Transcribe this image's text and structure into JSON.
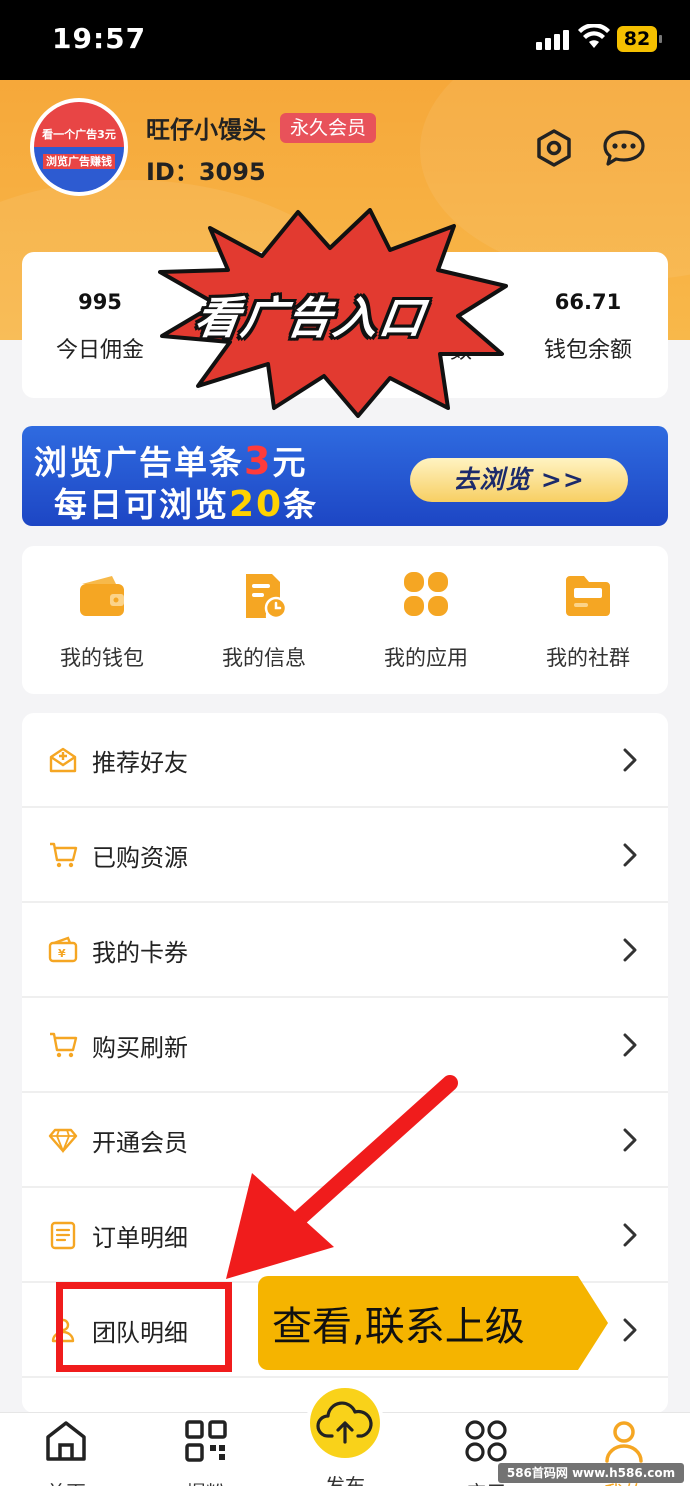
{
  "status_bar": {
    "time": "19:57",
    "battery": "82"
  },
  "profile": {
    "avatar_top": "看一个广告3元",
    "avatar_bottom": "浏览广告赚钱",
    "username": "旺仔小馒头",
    "member_badge": "永久会员",
    "id_text": "ID：3095"
  },
  "stats": [
    {
      "value": "995",
      "label": "今日佣金"
    },
    {
      "value": "66.71",
      "label": "钱包余额"
    }
  ],
  "stats_partial_label": "数",
  "overlay_burst": "看广告入口",
  "banner": {
    "line1_a": "浏览广告单条",
    "line1_num": "3",
    "line1_b": "元",
    "line2_a": "每日可浏览",
    "line2_num": "20",
    "line2_b": "条",
    "button": "去浏览 >>"
  },
  "quick_grid": [
    {
      "label": "我的钱包",
      "icon": "wallet-icon"
    },
    {
      "label": "我的信息",
      "icon": "info-doc-icon"
    },
    {
      "label": "我的应用",
      "icon": "apps-icon"
    },
    {
      "label": "我的社群",
      "icon": "folder-icon"
    }
  ],
  "menu": [
    {
      "label": "推荐好友",
      "icon": "invite-icon"
    },
    {
      "label": "已购资源",
      "icon": "cart-icon"
    },
    {
      "label": "我的卡券",
      "icon": "coupon-icon"
    },
    {
      "label": "购买刷新",
      "icon": "cart-icon"
    },
    {
      "label": "开通会员",
      "icon": "diamond-icon"
    },
    {
      "label": "订单明细",
      "icon": "order-icon"
    },
    {
      "label": "团队明细",
      "icon": "team-icon"
    }
  ],
  "callout": "查看,联系上级",
  "tabbar": [
    {
      "label": "首页",
      "icon": "home-icon"
    },
    {
      "label": "爆粉",
      "icon": "qr-icon"
    },
    {
      "label": "发布",
      "icon": "upload-cloud-icon"
    },
    {
      "label": "应用",
      "icon": "apps-outline-icon"
    },
    {
      "label": "我的",
      "icon": "user-icon"
    }
  ],
  "watermark": "586首码网 www.h586.com",
  "colors": {
    "accent": "#f5a623",
    "header": "#f6a83a",
    "banner": "#2453d1",
    "annotation_red": "#f01c1c",
    "callout": "#f5b400"
  }
}
